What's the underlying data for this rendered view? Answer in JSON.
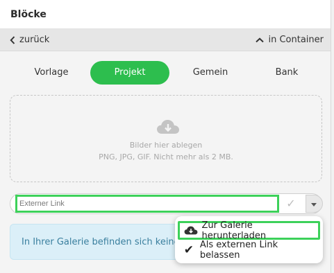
{
  "header": {
    "title": "Blöcke"
  },
  "nav": {
    "back_label": "zurück",
    "container_label": "in Container"
  },
  "tabs": [
    {
      "label": "Vorlage",
      "active": false
    },
    {
      "label": "Projekt",
      "active": true
    },
    {
      "label": "Gemein",
      "active": false
    },
    {
      "label": "Bank",
      "active": false
    }
  ],
  "dropzone": {
    "line1": "Bilder hier ablegen",
    "line2": "PNG, JPG, GIF. Nicht mehr als 2 MB.",
    "icon": "cloud-download-icon"
  },
  "link_input": {
    "placeholder": "Externer Link",
    "value": ""
  },
  "info": {
    "text": "In Ihrer Galerie befinden sich keine Bilder"
  },
  "menu": {
    "items": [
      {
        "label": "Zur Galerie herunterladen",
        "icon": "cloud-download-icon"
      },
      {
        "label": "Als externen Link belassen",
        "icon": "check-icon"
      }
    ]
  },
  "colors": {
    "accent": "#2dbe4e",
    "highlight": "#3dd15a",
    "info_bg": "#dbeff8",
    "info_text": "#3a7f9e"
  }
}
